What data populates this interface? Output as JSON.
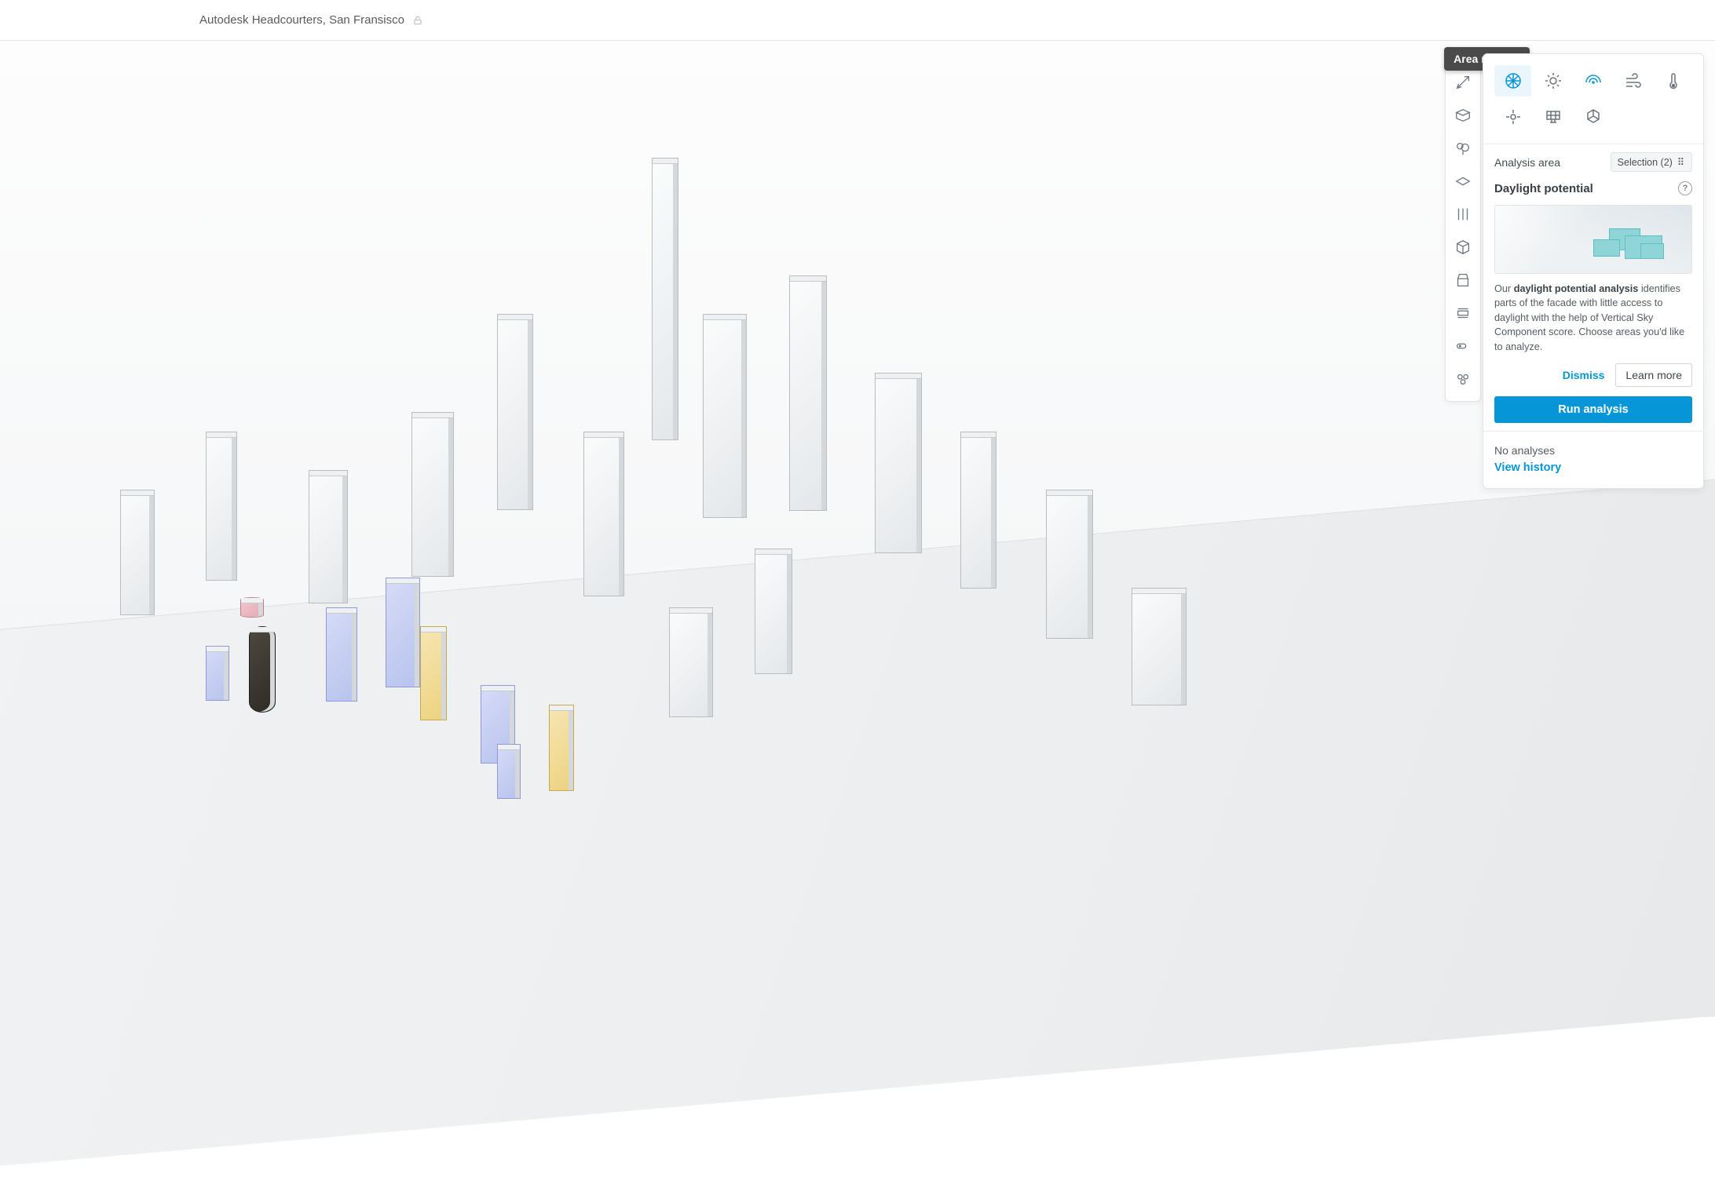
{
  "header": {
    "project_title": "Autodesk Headcourters, San Fransisco"
  },
  "tooltip": {
    "text": "Area metrics"
  },
  "panel": {
    "analysis_area_label": "Analysis area",
    "selection_chip": "Selection (2)",
    "section_title": "Daylight potential",
    "desc_prefix": "Our ",
    "desc_bold": "daylight potential analysis",
    "desc_rest": " identifies parts of the facade with little access to daylight with the help of Vertical Sky Component score. Choose areas you'd like to analyze.",
    "dismiss": "Dismiss",
    "learn_more": "Learn more",
    "run": "Run analysis",
    "no_analyses": "No analyses",
    "view_history": "View history"
  }
}
